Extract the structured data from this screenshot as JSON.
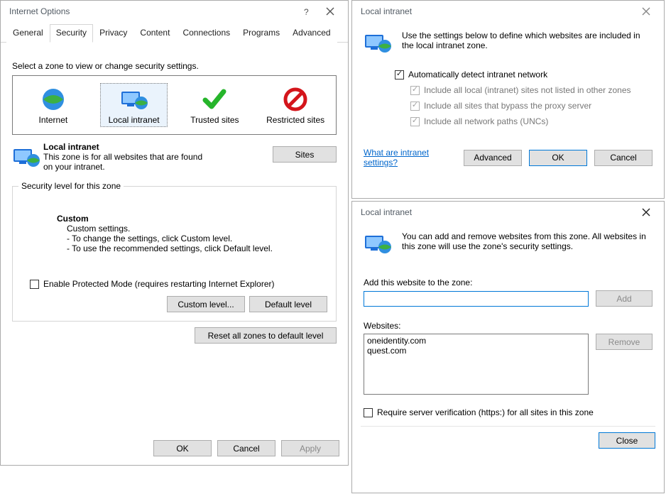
{
  "internet_options": {
    "title": "Internet Options",
    "tabs": [
      "General",
      "Security",
      "Privacy",
      "Content",
      "Connections",
      "Programs",
      "Advanced"
    ],
    "active_tab": 1,
    "zone_prompt": "Select a zone to view or change security settings.",
    "zones": [
      {
        "label": "Internet",
        "icon": "globe"
      },
      {
        "label": "Local intranet",
        "icon": "monitor-globe"
      },
      {
        "label": "Trusted sites",
        "icon": "check"
      },
      {
        "label": "Restricted sites",
        "icon": "no"
      }
    ],
    "selected_zone": {
      "title": "Local intranet",
      "desc": "This zone is for all websites that are found on your intranet."
    },
    "sites_btn": "Sites",
    "security_level": {
      "legend": "Security level for this zone",
      "heading": "Custom",
      "line1": "Custom settings.",
      "line2": "- To change the settings, click Custom level.",
      "line3": "- To use the recommended settings, click Default level."
    },
    "protected_mode": "Enable Protected Mode (requires restarting Internet Explorer)",
    "custom_level_btn": "Custom level...",
    "default_level_btn": "Default level",
    "reset_btn": "Reset all zones to default level",
    "ok": "OK",
    "cancel": "Cancel",
    "apply": "Apply"
  },
  "intranet1": {
    "title": "Local intranet",
    "desc": "Use the settings below to define which websites are included in the local intranet zone.",
    "auto": "Automatically detect intranet network",
    "opt1": "Include all local (intranet) sites not listed in other zones",
    "opt2": "Include all sites that bypass the proxy server",
    "opt3": "Include all network paths (UNCs)",
    "link": "What are intranet settings?",
    "advanced": "Advanced",
    "ok": "OK",
    "cancel": "Cancel"
  },
  "intranet2": {
    "title": "Local intranet",
    "desc": "You can add and remove websites from this zone. All websites in this zone will use the zone's security settings.",
    "add_label": "Add this website to the zone:",
    "add_value": "",
    "add_btn": "Add",
    "websites_label": "Websites:",
    "websites": [
      "oneidentity.com",
      "quest.com"
    ],
    "remove_btn": "Remove",
    "https_label": "Require server verification (https:) for all sites in this zone",
    "close": "Close"
  }
}
